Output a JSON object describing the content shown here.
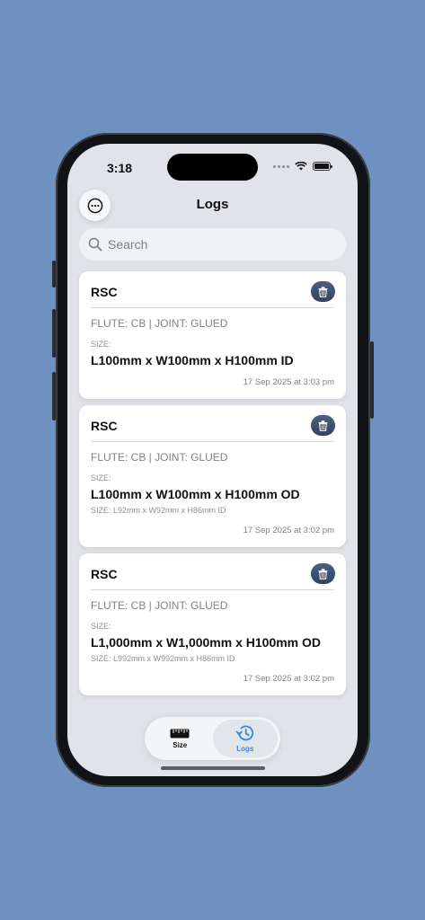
{
  "status_bar": {
    "time": "3:18"
  },
  "header": {
    "title": "Logs",
    "menu_icon": "ellipsis-circle-icon"
  },
  "search": {
    "placeholder": "Search",
    "value": ""
  },
  "logs": [
    {
      "type": "RSC",
      "meta": "FLUTE: CB | JOINT: GLUED",
      "size_label": "SIZE:",
      "dimensions": "L100mm x W100mm x H100mm ID",
      "inner": "",
      "timestamp": "17 Sep 2025 at 3:03 pm"
    },
    {
      "type": "RSC",
      "meta": "FLUTE: CB | JOINT: GLUED",
      "size_label": "SIZE:",
      "dimensions": "L100mm x W100mm x H100mm OD",
      "inner": "SIZE: L92mm x W92mm x H86mm ID",
      "timestamp": "17 Sep 2025 at 3:02 pm"
    },
    {
      "type": "RSC",
      "meta": "FLUTE: CB | JOINT: GLUED",
      "size_label": "SIZE:",
      "dimensions": "L1,000mm x W1,000mm x H100mm OD",
      "inner": "SIZE: L992mm x W992mm x H86mm ID",
      "timestamp": "17 Sep 2025 at 3:02 pm"
    }
  ],
  "tabs": [
    {
      "label": "Size",
      "icon": "ruler-icon",
      "active": false
    },
    {
      "label": "Logs",
      "icon": "history-clock-icon",
      "active": true
    }
  ],
  "colors": {
    "background": "#6f91c1",
    "accent": "#3a86e0",
    "delete_button": "#3d4b6b"
  }
}
